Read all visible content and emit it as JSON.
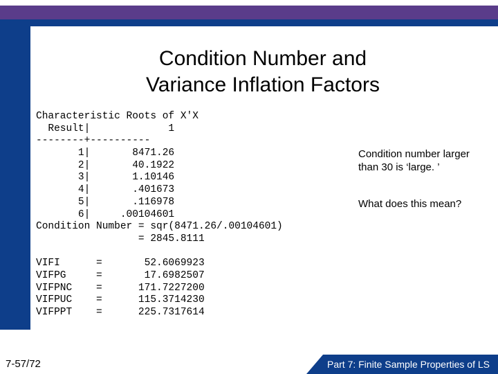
{
  "title_l1": "Condition Number and",
  "title_l2": "Variance Inflation Factors",
  "mono": "Characteristic Roots of X'X\n  Result|             1\n--------+----------\n       1|       8471.26\n       2|       40.1922\n       3|       1.10146\n       4|       .401673\n       5|       .116978\n       6|     .00104601\nCondition Number = sqr(8471.26/.00104601)\n                 = 2845.8111\n\nVIFI      =       52.6069923\nVIFPG     =       17.6982507\nVIFPNC    =      171.7227200\nVIFPUC    =      115.3714230\nVIFPPT    =      225.7317614",
  "note1": "Condition number larger than 30 is ‘large. ’",
  "note2": "What does this mean?",
  "footer_left": "7-57/72",
  "footer_right": "Part 7: Finite Sample Properties of LS"
}
